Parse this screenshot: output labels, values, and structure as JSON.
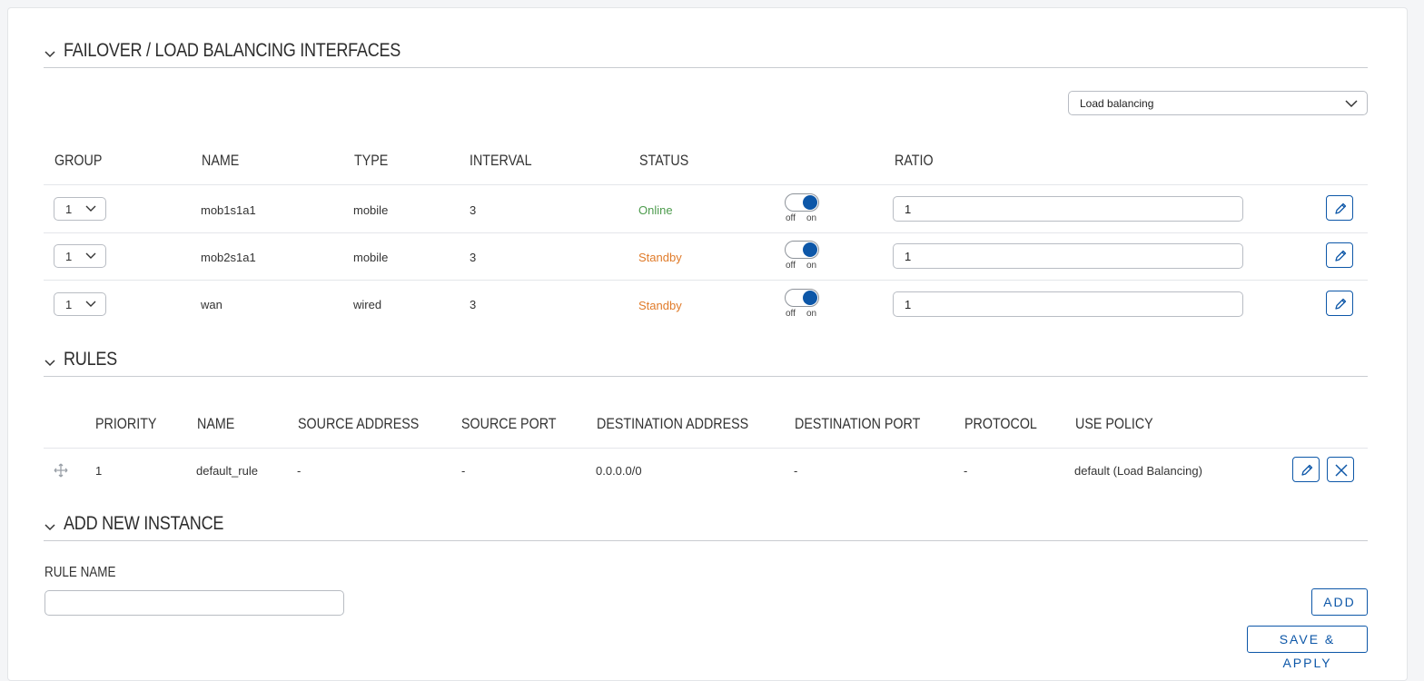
{
  "sections": {
    "interfaces_title": "FAILOVER / LOAD BALANCING INTERFACES",
    "rules_title": "RULES",
    "add_title": "ADD NEW INSTANCE"
  },
  "mode_select": {
    "value": "Load balancing"
  },
  "interfaces": {
    "headers": {
      "group": "GROUP",
      "name": "NAME",
      "type": "TYPE",
      "interval": "INTERVAL",
      "status": "STATUS",
      "ratio": "RATIO"
    },
    "toggle_off": "off",
    "toggle_on": "on",
    "rows": [
      {
        "group": "1",
        "name": "mob1s1a1",
        "type": "mobile",
        "interval": "3",
        "status": "Online",
        "ratio": "1"
      },
      {
        "group": "1",
        "name": "mob2s1a1",
        "type": "mobile",
        "interval": "3",
        "status": "Standby",
        "ratio": "1"
      },
      {
        "group": "1",
        "name": "wan",
        "type": "wired",
        "interval": "3",
        "status": "Standby",
        "ratio": "1"
      }
    ]
  },
  "rules": {
    "headers": {
      "priority": "PRIORITY",
      "name": "NAME",
      "source_address": "SOURCE ADDRESS",
      "source_port": "SOURCE PORT",
      "destination_address": "DESTINATION ADDRESS",
      "destination_port": "DESTINATION PORT",
      "protocol": "PROTOCOL",
      "use_policy": "USE POLICY"
    },
    "rows": [
      {
        "priority": "1",
        "name": "default_rule",
        "source_address": "-",
        "source_port": "-",
        "destination_address": "0.0.0.0/0",
        "destination_port": "-",
        "protocol": "-",
        "use_policy": "default (Load Balancing)"
      }
    ]
  },
  "add_instance": {
    "rule_name_label": "RULE NAME",
    "rule_name_value": "",
    "add_button": "ADD"
  },
  "save_button": "SAVE & APPLY",
  "colors": {
    "accent": "#0d57a8",
    "online": "#4c9b4c",
    "standby": "#e07b2a"
  },
  "icons": {
    "edit": "pencil-icon",
    "delete": "close-icon",
    "drag": "move-icon",
    "dropdown": "chevron-down-icon",
    "collapse": "chevron-down-icon"
  }
}
